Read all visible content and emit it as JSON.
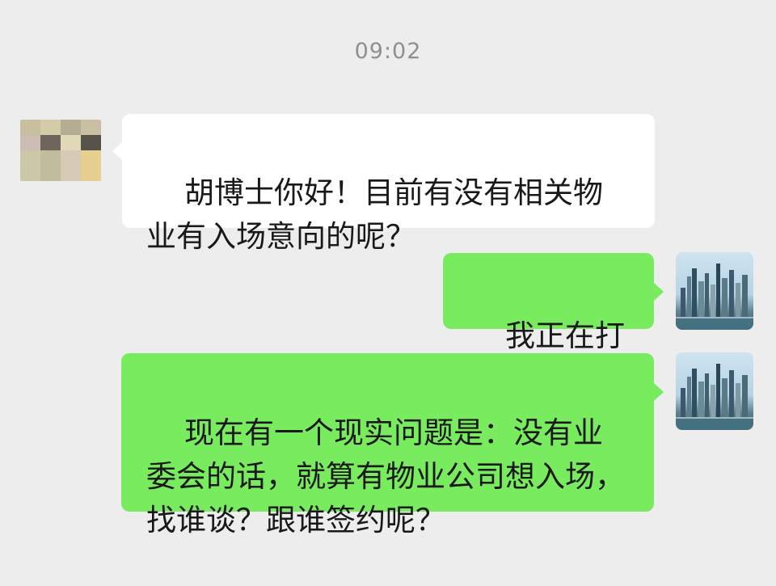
{
  "chat": {
    "timestamp": "09:02",
    "messages": [
      {
        "direction": "incoming",
        "text": "胡博士你好！目前有没有相关物业有入场意向的呢？",
        "avatar": "pixelated-avatar"
      },
      {
        "direction": "outgoing",
        "text": "我正在打听",
        "avatar": "city-skyline-avatar"
      },
      {
        "direction": "outgoing",
        "text": "现在有一个现实问题是：没有业委会的话，就算有物业公司想入场，找谁谈？跟谁签约呢？",
        "avatar": "city-skyline-avatar"
      }
    ]
  },
  "colors": {
    "background": "#ededed",
    "incoming_bubble": "#ffffff",
    "outgoing_bubble": "#78ec5e",
    "timestamp_text": "#8f8f8f",
    "message_text": "#191919"
  }
}
